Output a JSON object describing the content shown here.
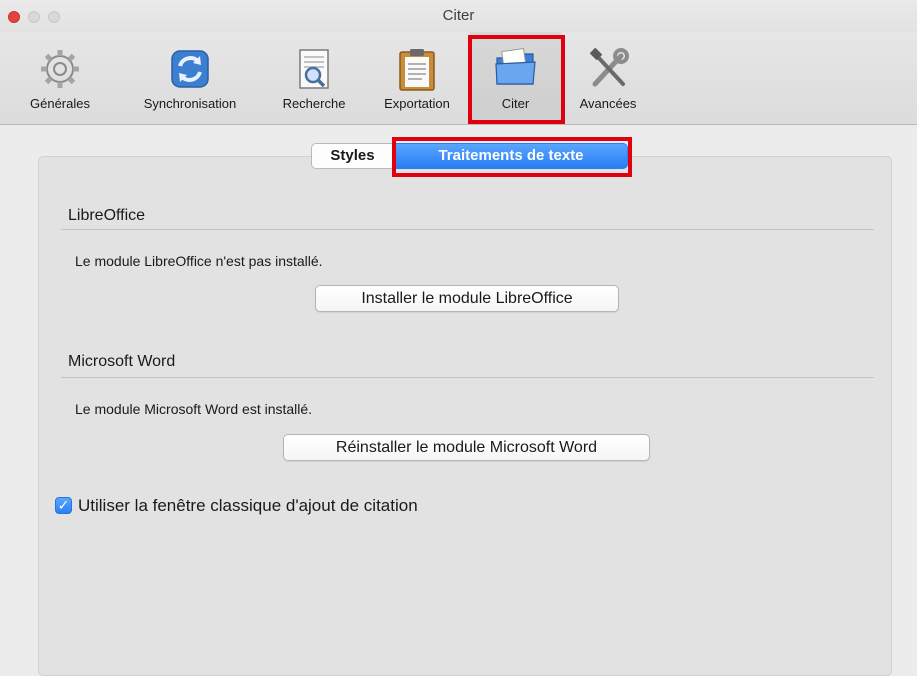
{
  "window": {
    "title": "Citer"
  },
  "toolbar": {
    "items": [
      {
        "label": "Générales",
        "icon": "gear-icon"
      },
      {
        "label": "Synchronisation",
        "icon": "sync-icon"
      },
      {
        "label": "Recherche",
        "icon": "search-document-icon"
      },
      {
        "label": "Exportation",
        "icon": "clipboard-icon"
      },
      {
        "label": "Citer",
        "icon": "folder-icon",
        "selected": true
      },
      {
        "label": "Avancées",
        "icon": "tools-icon"
      }
    ]
  },
  "tabs": {
    "styles": "Styles",
    "word_processors": "Traitements de texte",
    "selected": "Traitements de texte"
  },
  "libreoffice": {
    "title": "LibreOffice",
    "status": "Le module LibreOffice n'est pas installé.",
    "button": "Installer le module LibreOffice"
  },
  "word": {
    "title": "Microsoft Word",
    "status": "Le module Microsoft Word est installé.",
    "button": "Réinstaller le module Microsoft Word"
  },
  "classic_window": {
    "label": "Utiliser la fenêtre classique d'ajout de citation",
    "checked": true
  },
  "colors": {
    "highlight": "#e0000f",
    "accent": "#2a7cf3"
  }
}
